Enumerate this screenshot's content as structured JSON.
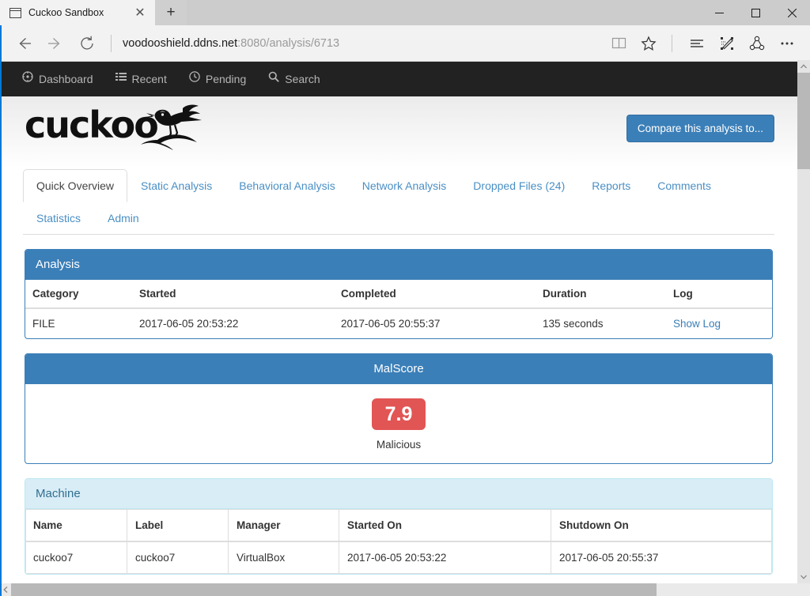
{
  "browser": {
    "tab": {
      "title": "Cuckoo Sandbox",
      "favicon": "window-icon",
      "close": "✕"
    },
    "newtab_label": "+",
    "window_controls": {
      "minimize": "minimize-icon",
      "maximize": "maximize-icon",
      "close": "close-icon"
    },
    "nav": {
      "back": "back-arrow-icon",
      "forward": "forward-arrow-icon",
      "refresh": "refresh-icon",
      "url_main": "voodooshield.ddns.net",
      "url_rest": ":8080/analysis/6713",
      "reading_view": "book-icon",
      "favorite": "star-icon",
      "hub": "hub-lines-icon",
      "web_note": "pencil-note-icon",
      "share": "share-icon",
      "more": "more-ellipsis-icon"
    }
  },
  "topnav": {
    "items": [
      {
        "label": "Dashboard",
        "icon": "dashboard-icon",
        "glyph": "⊙"
      },
      {
        "label": "Recent",
        "icon": "list-icon",
        "glyph": "≡"
      },
      {
        "label": "Pending",
        "icon": "clock-icon",
        "glyph": "◴"
      },
      {
        "label": "Search",
        "icon": "search-icon",
        "glyph": "⚲"
      }
    ]
  },
  "brand": {
    "logo_text": "cuckoo",
    "logo_icon": "cuckoo-bird-logo",
    "compare_button": "Compare this analysis to..."
  },
  "tabs": {
    "row1": [
      {
        "label": "Quick Overview",
        "active": true
      },
      {
        "label": "Static Analysis",
        "active": false
      },
      {
        "label": "Behavioral Analysis",
        "active": false
      },
      {
        "label": "Network Analysis",
        "active": false
      },
      {
        "label": "Dropped Files (24)",
        "active": false
      },
      {
        "label": "Reports",
        "active": false
      },
      {
        "label": "Comments",
        "active": false
      }
    ],
    "row2": [
      {
        "label": "Statistics",
        "active": false
      },
      {
        "label": "Admin",
        "active": false
      }
    ]
  },
  "analysis_panel": {
    "title": "Analysis",
    "headers": [
      "Category",
      "Started",
      "Completed",
      "Duration",
      "Log"
    ],
    "row": {
      "category": "FILE",
      "started": "2017-06-05 20:53:22",
      "completed": "2017-06-05 20:55:37",
      "duration": "135 seconds",
      "log_link": "Show Log"
    }
  },
  "malscore_panel": {
    "title": "MalScore",
    "score": "7.9",
    "verdict": "Malicious",
    "score_color": "#e15554"
  },
  "machine_panel": {
    "title": "Machine",
    "headers": [
      "Name",
      "Label",
      "Manager",
      "Started On",
      "Shutdown On"
    ],
    "row": {
      "name": "cuckoo7",
      "label": "cuckoo7",
      "manager": "VirtualBox",
      "started_on": "2017-06-05 20:53:22",
      "shutdown_on": "2017-06-05 20:55:37"
    }
  },
  "colors": {
    "panel_blue": "#3b7fb8",
    "link_blue": "#4a8fc4",
    "nav_dark": "#222222",
    "info_bg": "#d9edf7"
  }
}
